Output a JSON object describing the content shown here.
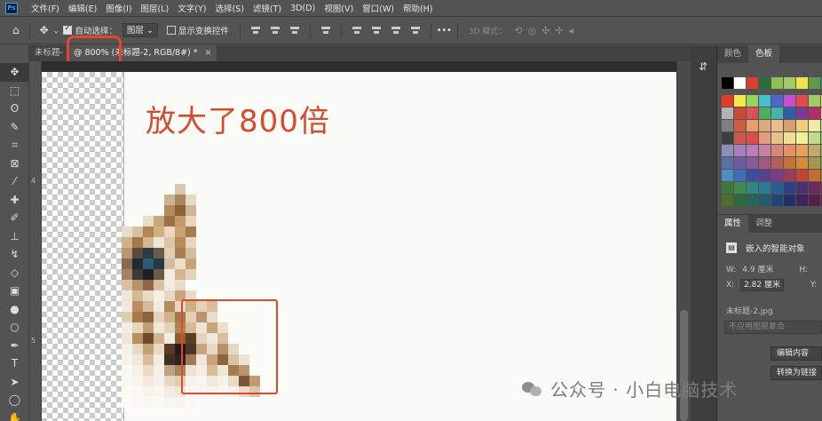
{
  "menubar": {
    "logo": "Ps",
    "items": [
      "文件(F)",
      "编辑(E)",
      "图像(I)",
      "图层(L)",
      "文字(Y)",
      "选择(S)",
      "滤镜(T)",
      "3D(D)",
      "视图(V)",
      "窗口(W)",
      "帮助(H)"
    ]
  },
  "options": {
    "auto_select_label": "自动选择：",
    "auto_select_target": "图层",
    "show_transform_label": "显示变换控件",
    "more": "•••",
    "mode_3d_label": "3D 模式："
  },
  "tabs": {
    "prev_tab": "未标题-",
    "active_tab": "@ 800% (未标题-2, RGB/8#) *",
    "close": "×"
  },
  "ruler": {
    "marks": [
      "4",
      "5"
    ]
  },
  "canvas": {
    "caption": "放大了800倍",
    "zoom_percent": 800
  },
  "panels": {
    "swatch_tabs": [
      "颜色",
      "色板"
    ],
    "active_swatch_tab": "色板",
    "swatches": [
      [
        "#000000",
        "#ffffff",
        "#e03c31",
        "#2a6f3a",
        "#8fc057",
        "#a3c96a",
        "#f0e34c",
        "#5c9a43",
        "#2d7bc4"
      ],
      [
        "#e53a2c",
        "#f6e94a",
        "#9bd25f",
        "#49c0c9",
        "#4d68c9",
        "#c94fd1",
        "#e4484f",
        "#a3c96a",
        "#e9ea4d"
      ],
      [
        "#b3b3b3",
        "#c94a3a",
        "#dd4f59",
        "#4cad60",
        "#45b3ad",
        "#2e5ea6",
        "#7d3b8f",
        "#b42d66",
        "#e6d3a6"
      ],
      [
        "#7f7f7f",
        "#d05c42",
        "#e6a068",
        "#d9ac7b",
        "#e9bd91",
        "#d99d6e",
        "#f0cd7e",
        "#f4e7a4",
        "#c9d8a3"
      ],
      [
        "#3f3f3f",
        "#c95a49",
        "#d94d4b",
        "#e89a7c",
        "#eabf8e",
        "#f2df90",
        "#f3f196",
        "#bddc88",
        "#93cc7c"
      ],
      [
        "#8f8fb5",
        "#a77fbc",
        "#b77fb6",
        "#c582a0",
        "#d3897f",
        "#e69161",
        "#e8a25b",
        "#c3a96d",
        "#9ec15d"
      ],
      [
        "#5c6ea3",
        "#6f5c9e",
        "#875b96",
        "#a05a82",
        "#b3605b",
        "#c6723d",
        "#d28d35",
        "#a2984f",
        "#78a743"
      ],
      [
        "#4f8dc6",
        "#3e6fb8",
        "#3c4ea2",
        "#5a3e8f",
        "#7c3b83",
        "#9b3a5c",
        "#bf4539",
        "#c86b2f",
        "#96893a"
      ],
      [
        "#3d7a3c",
        "#3f8a55",
        "#2e8779",
        "#2d7a97",
        "#2b5d94",
        "#2f3f82",
        "#4a2f72",
        "#6a2b60",
        "#862a3f"
      ],
      [
        "#4f6e2c",
        "#2e6b3b",
        "#27655a",
        "#225b6e",
        "#1f4570",
        "#232f66",
        "#3a2558",
        "#53224a",
        "#6a2033"
      ]
    ],
    "props_tabs": [
      "属性",
      "调整"
    ],
    "active_props_tab": "属性",
    "smart_object_label": "嵌入的智能对象",
    "w_label": "W:",
    "w_value": "4.9 厘米",
    "h_label": "H:",
    "x_label": "X:",
    "x_value": "2.82 厘米",
    "y_label": "Y:",
    "layer_name": "未标题-2.jpg",
    "comp_placeholder": "不应用图层复合",
    "edit_button": "编辑内容",
    "convert_button": "转换为链接"
  },
  "watermark": {
    "text": "公众号 · 小白电脑技术"
  },
  "colors": {
    "accent_red": "#e0492e",
    "caption_red": "#d74a2d",
    "ui_gray": "#535353"
  }
}
